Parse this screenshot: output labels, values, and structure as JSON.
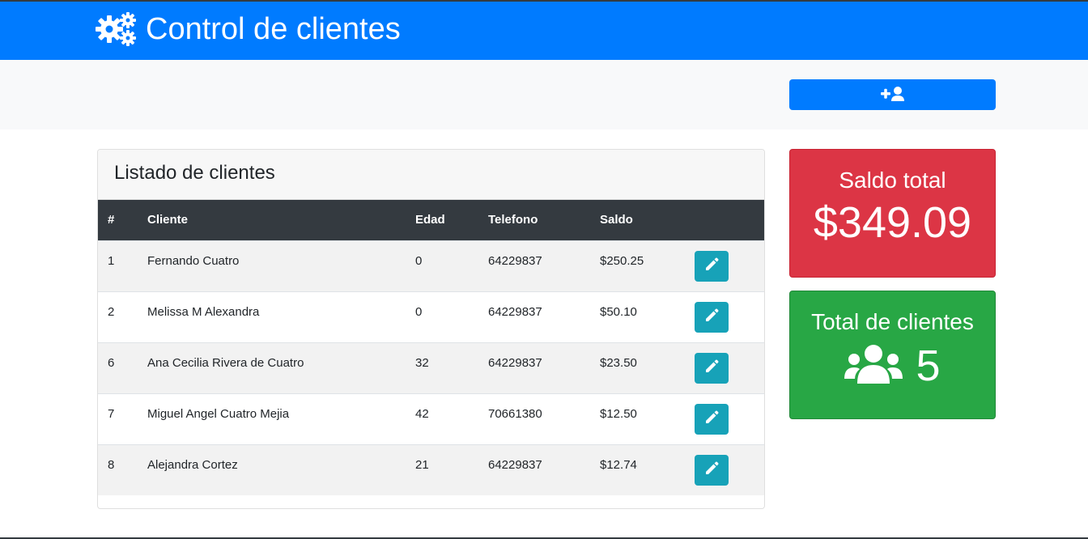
{
  "header": {
    "title": "Control de clientes",
    "icon": "gears-icon",
    "color": "#007bff"
  },
  "toolbar": {
    "add_button_icon": "user-plus-icon"
  },
  "clients_card": {
    "title": "Listado de clientes",
    "columns": [
      "#",
      "Cliente",
      "Edad",
      "Telefono",
      "Saldo"
    ],
    "rows": [
      {
        "id": "1",
        "name": "Fernando Cuatro",
        "age": "0",
        "phone": "64229837",
        "balance": "$250.25"
      },
      {
        "id": "2",
        "name": "Melissa M Alexandra",
        "age": "0",
        "phone": "64229837",
        "balance": "$50.10"
      },
      {
        "id": "6",
        "name": "Ana Cecilia Rivera de Cuatro",
        "age": "32",
        "phone": "64229837",
        "balance": "$23.50"
      },
      {
        "id": "7",
        "name": "Miguel Angel Cuatro Mejia",
        "age": "42",
        "phone": "70661380",
        "balance": "$12.50"
      },
      {
        "id": "8",
        "name": "Alejandra Cortez",
        "age": "21",
        "phone": "64229837",
        "balance": "$12.74"
      }
    ],
    "row_action_icon": "pencil-icon"
  },
  "stats": {
    "balance": {
      "title": "Saldo total",
      "value": "$349.09",
      "color": "#dc3545"
    },
    "clients": {
      "title": "Total de clientes",
      "value": "5",
      "icon": "users-icon",
      "color": "#28a745"
    }
  }
}
